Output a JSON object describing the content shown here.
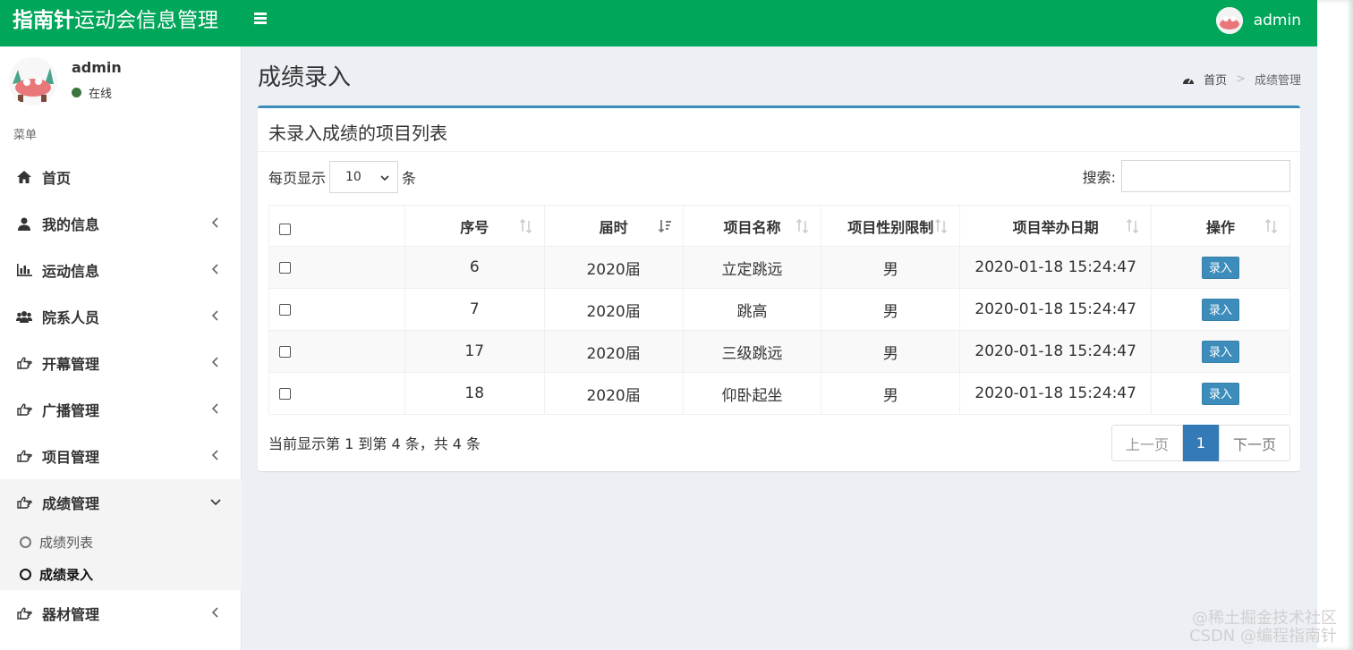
{
  "brand": {
    "bold": "指南针",
    "rest": "运动会信息管理"
  },
  "nav": {
    "user_name": "admin"
  },
  "sidebar": {
    "user_name": "admin",
    "status": "在线",
    "menu_header": "菜单",
    "items": [
      {
        "label": "首页",
        "icon": "home-icon"
      },
      {
        "label": "我的信息",
        "icon": "user-icon"
      },
      {
        "label": "运动信息",
        "icon": "bar-chart-icon"
      },
      {
        "label": "院系人员",
        "icon": "users-icon"
      },
      {
        "label": "开幕管理",
        "icon": "hand-point-icon"
      },
      {
        "label": "广播管理",
        "icon": "hand-point-icon"
      },
      {
        "label": "项目管理",
        "icon": "hand-point-icon"
      },
      {
        "label": "成绩管理",
        "icon": "hand-point-icon"
      },
      {
        "label": "器材管理",
        "icon": "hand-point-icon"
      }
    ],
    "sub_items": [
      {
        "label": "成绩列表"
      },
      {
        "label": "成绩录入"
      }
    ]
  },
  "page": {
    "title": "成绩录入",
    "breadcrumb": {
      "home": "首页",
      "separator": ">",
      "current": "成绩管理"
    }
  },
  "box": {
    "title": "未录入成绩的项目列表",
    "length_prefix": "每页显示",
    "length_value": "10",
    "length_suffix": "条",
    "search_label": "搜索:",
    "search_value": ""
  },
  "table": {
    "headers": [
      "序号",
      "届时",
      "项目名称",
      "项目性别限制",
      "项目举办日期",
      "操作"
    ],
    "rows": [
      {
        "id": "6",
        "session": "2020届",
        "name": "立定跳远",
        "gender": "男",
        "date": "2020-01-18 15:24:47",
        "action": "录入"
      },
      {
        "id": "7",
        "session": "2020届",
        "name": "跳高",
        "gender": "男",
        "date": "2020-01-18 15:24:47",
        "action": "录入"
      },
      {
        "id": "17",
        "session": "2020届",
        "name": "三级跳远",
        "gender": "男",
        "date": "2020-01-18 15:24:47",
        "action": "录入"
      },
      {
        "id": "18",
        "session": "2020届",
        "name": "仰卧起坐",
        "gender": "男",
        "date": "2020-01-18 15:24:47",
        "action": "录入"
      }
    ]
  },
  "footer": {
    "info": "当前显示第 1 到第 4 条，共 4 条",
    "prev": "上一页",
    "page": "1",
    "next": "下一页"
  },
  "watermark": {
    "line1": "@稀土掘金技术社区",
    "line2": "CSDN @编程指南针"
  },
  "colors": {
    "navbar": "#00a65a",
    "primary": "#3c8dbc",
    "background": "#ecf0f5"
  }
}
